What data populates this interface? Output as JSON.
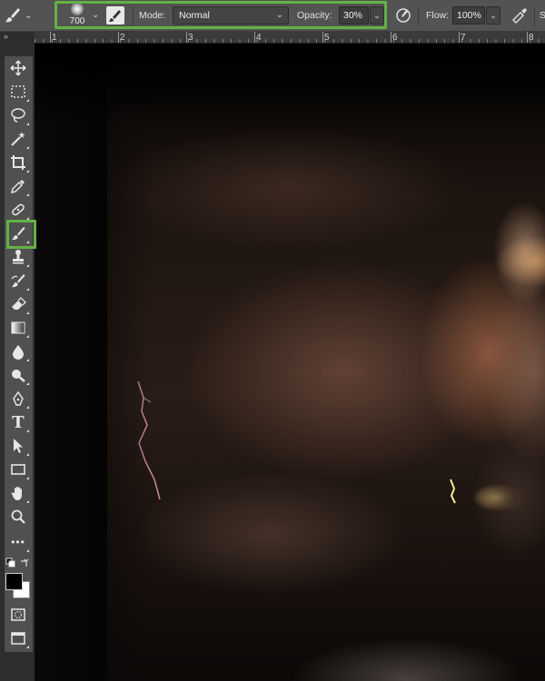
{
  "options_bar": {
    "brush_size": "700",
    "mode_label": "Mode:",
    "mode_value": "Normal",
    "opacity_label": "Opacity:",
    "opacity_value": "30%",
    "flow_label": "Flow:",
    "flow_value": "100%",
    "highlight_color": "#63b146"
  },
  "rulers": {
    "h_labels": [
      "1",
      "2",
      "3",
      "4",
      "5",
      "6",
      "7",
      "8"
    ]
  },
  "toolbar": {
    "tools": [
      "move-tool",
      "marquee-tool",
      "lasso-tool",
      "magic-wand-tool",
      "crop-tool",
      "eyedropper-tool",
      "healing-brush-tool",
      "brush-tool",
      "clone-stamp-tool",
      "history-brush-tool",
      "eraser-tool",
      "gradient-tool",
      "blur-tool",
      "dodge-tool",
      "pen-tool",
      "type-tool",
      "path-selection-tool",
      "rectangle-tool",
      "hand-tool",
      "zoom-tool",
      "more-tools"
    ],
    "selected_tool": "brush-tool",
    "type_glyph": "T",
    "more_glyph": "•••"
  },
  "canvas": {
    "subject": "storm-clouds-double-exposure-portrait"
  }
}
